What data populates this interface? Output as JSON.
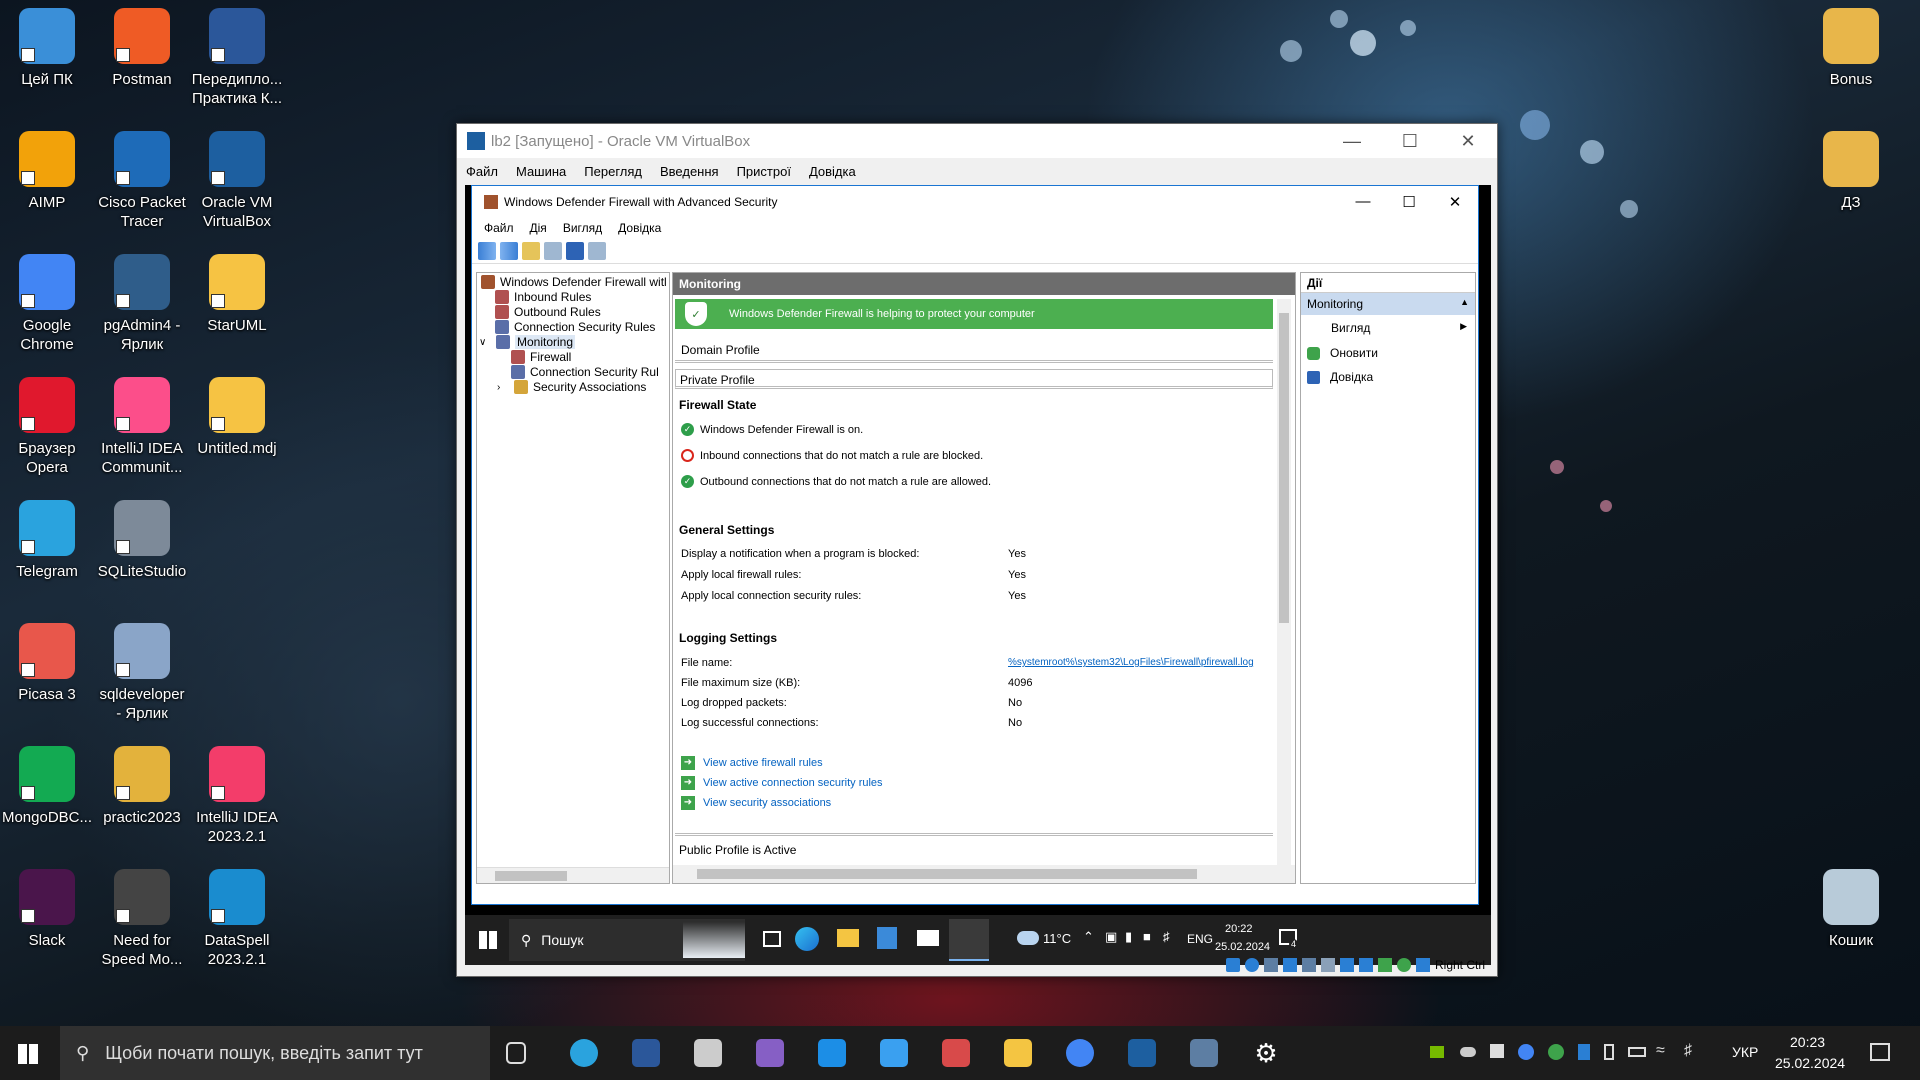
{
  "desktop": {
    "icons": [
      {
        "label": "Цей ПК",
        "color": "#3a8fd8"
      },
      {
        "label": "Postman",
        "color": "#ef5b25"
      },
      {
        "label": "Передипло... Практика К...",
        "color": "#2b579a"
      },
      {
        "label": "AIMP",
        "color": "#f2a20a"
      },
      {
        "label": "Cisco Packet Tracer",
        "color": "#1e6bb8"
      },
      {
        "label": "Oracle VM VirtualBox",
        "color": "#1d5fa0"
      },
      {
        "label": "Google Chrome",
        "color": "#4285f4"
      },
      {
        "label": "pgAdmin4 - Ярлик",
        "color": "#2f5d8a"
      },
      {
        "label": "StarUML",
        "color": "#f6c343"
      },
      {
        "label": "Браузер Opera",
        "color": "#e0182d"
      },
      {
        "label": "IntelliJ IDEA Communit...",
        "color": "#fc4e8a"
      },
      {
        "label": "Untitled.mdj",
        "color": "#f6c343"
      },
      {
        "label": "Telegram",
        "color": "#2aa3de"
      },
      {
        "label": "SQLiteStudio",
        "color": "#7d8a99"
      },
      {
        "label": "Picasa 3",
        "color": "#e8574b"
      },
      {
        "label": "sqldeveloper - Ярлик",
        "color": "#8aa5c8"
      },
      {
        "label": "MongoDBC...",
        "color": "#13aa52"
      },
      {
        "label": "practic2023",
        "color": "#e3b23c"
      },
      {
        "label": "IntelliJ IDEA 2023.2.1",
        "color": "#f33d6a"
      },
      {
        "label": "Slack",
        "color": "#4a154b"
      },
      {
        "label": "Need for Speed Mo...",
        "color": "#444"
      },
      {
        "label": "DataSpell 2023.2.1",
        "color": "#1a8ccf"
      },
      {
        "label": "Bonus",
        "color": "#e8b64a"
      },
      {
        "label": "ДЗ",
        "color": "#e8b64a"
      },
      {
        "label": "Кошик",
        "color": "#b8cbd9"
      }
    ]
  },
  "vbox": {
    "title": "lb2 [Запущено] - Oracle VM VirtualBox",
    "menu": [
      "Файл",
      "Машина",
      "Перегляд",
      "Введення",
      "Пристрої",
      "Довідка"
    ],
    "status_host_key": "Right Ctrl"
  },
  "fw": {
    "title": "Windows Defender Firewall with Advanced Security",
    "menu": [
      "Файл",
      "Дія",
      "Вигляд",
      "Довідка"
    ],
    "tree": {
      "root": "Windows Defender Firewall witl",
      "inbound": "Inbound Rules",
      "outbound": "Outbound Rules",
      "connsec": "Connection Security Rules",
      "monitoring": "Monitoring",
      "firewall": "Firewall",
      "connsec2": "Connection Security Rul",
      "secassoc": "Security Associations"
    },
    "center": {
      "header": "Monitoring",
      "banner": "Windows Defender Firewall is helping to protect your computer",
      "domain_profile": "Domain Profile",
      "private_profile": "Private Profile",
      "firewall_state_title": "Firewall State",
      "state1": "Windows Defender Firewall is on.",
      "state2": "Inbound connections that do not match a rule are blocked.",
      "state3": "Outbound connections that do not match a rule are allowed.",
      "general_title": "General Settings",
      "general": [
        {
          "k": "Display a notification when a program is blocked:",
          "v": "Yes"
        },
        {
          "k": "Apply local firewall rules:",
          "v": "Yes"
        },
        {
          "k": "Apply local connection security rules:",
          "v": "Yes"
        }
      ],
      "logging_title": "Logging Settings",
      "logging": [
        {
          "k": "File name:",
          "v": "%systemroot%\\system32\\LogFiles\\Firewall\\pfirewall.log"
        },
        {
          "k": "File maximum size (KB):",
          "v": "4096"
        },
        {
          "k": "Log dropped packets:",
          "v": "No"
        },
        {
          "k": "Log successful connections:",
          "v": "No"
        }
      ],
      "links": [
        "View active firewall rules",
        "View active connection security rules",
        "View security associations"
      ],
      "public_profile": "Public Profile is Active"
    },
    "actions": {
      "header": "Дії",
      "section": "Monitoring",
      "items": [
        "Вигляд",
        "Оновити",
        "Довідка"
      ]
    }
  },
  "guest_taskbar": {
    "search": "Пошук",
    "weather": "11°C",
    "lang": "ENG",
    "time": "20:22",
    "date": "25.02.2024",
    "notif_count": "4"
  },
  "host_taskbar": {
    "search_placeholder": "Щоби почати пошук, введіть запит тут",
    "lang": "УКР",
    "time": "20:23",
    "date": "25.02.2024"
  }
}
